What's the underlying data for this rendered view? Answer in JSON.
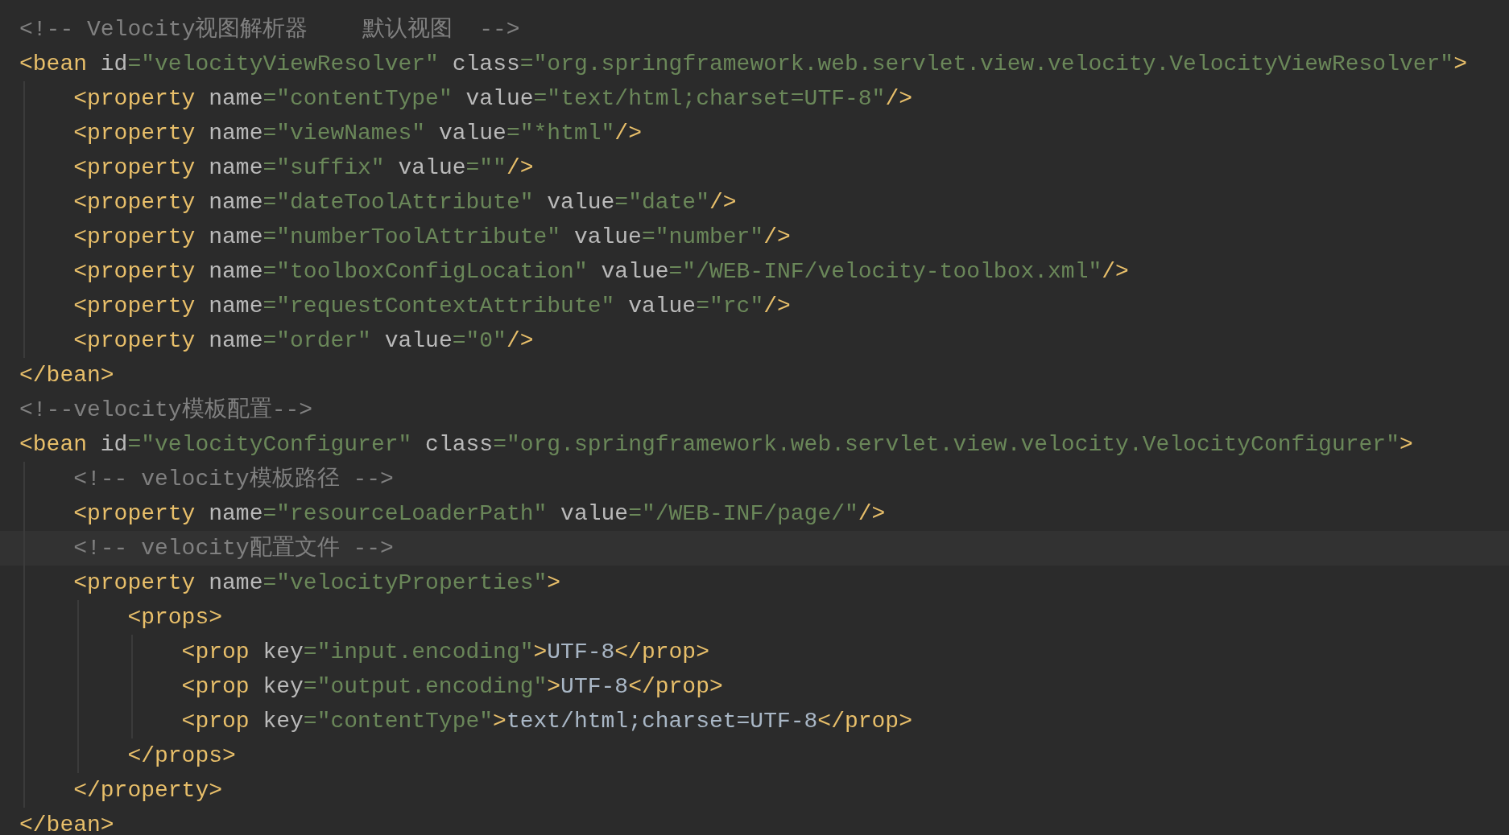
{
  "editor": {
    "lines": [
      {
        "text": "<!-- Velocity视图解析器    默认视图  -->",
        "current": false
      },
      {
        "text": "<bean id=\"velocityViewResolver\" class=\"org.springframework.web.servlet.view.velocity.VelocityViewResolver\">",
        "current": false,
        "children": [
          {
            "text": "<property name=\"contentType\" value=\"text/html;charset=UTF-8\"/>",
            "current": false
          },
          {
            "text": "<property name=\"viewNames\" value=\"*html\"/>",
            "current": false
          },
          {
            "text": "<property name=\"suffix\" value=\"\"/>",
            "current": false
          },
          {
            "text": "<property name=\"dateToolAttribute\" value=\"date\"/>",
            "current": false
          },
          {
            "text": "<property name=\"numberToolAttribute\" value=\"number\"/>",
            "current": false
          },
          {
            "text": "<property name=\"toolboxConfigLocation\" value=\"/WEB-INF/velocity-toolbox.xml\"/>",
            "current": false
          },
          {
            "text": "<property name=\"requestContextAttribute\" value=\"rc\"/>",
            "current": false
          },
          {
            "text": "<property name=\"order\" value=\"0\"/>",
            "current": false
          }
        ]
      },
      {
        "text": "</bean>",
        "current": false
      },
      {
        "text": "<!--velocity模板配置-->",
        "current": false
      },
      {
        "text": "<bean id=\"velocityConfigurer\" class=\"org.springframework.web.servlet.view.velocity.VelocityConfigurer\">",
        "current": false,
        "children": [
          {
            "text": "<!-- velocity模板路径 -->",
            "current": false
          },
          {
            "text": "<property name=\"resourceLoaderPath\" value=\"/WEB-INF/page/\"/>",
            "current": false
          },
          {
            "text": "<!-- velocity配置文件 -->",
            "current": true
          },
          {
            "text": "<property name=\"velocityProperties\">",
            "current": false,
            "children": [
              {
                "text": "<props>",
                "current": false,
                "children": [
                  {
                    "text": "<prop key=\"input.encoding\">UTF-8</prop>",
                    "current": false
                  },
                  {
                    "text": "<prop key=\"output.encoding\">UTF-8</prop>",
                    "current": false
                  },
                  {
                    "text": "<prop key=\"contentType\">text/html;charset=UTF-8</prop>",
                    "current": false
                  }
                ]
              },
              {
                "text": "</props>",
                "current": false
              }
            ]
          },
          {
            "text": "</property>",
            "current": false
          }
        ]
      },
      {
        "text": "</bean>",
        "current": false
      }
    ]
  }
}
